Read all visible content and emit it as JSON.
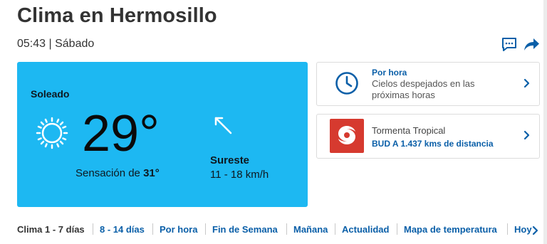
{
  "header": {
    "title": "Clima en Hermosillo",
    "time": "05:43",
    "separator": "|",
    "day": "Sábado"
  },
  "actions": {
    "comment_icon": "comment-icon",
    "share_icon": "share-icon"
  },
  "current": {
    "condition": "Soleado",
    "condition_icon": "sun-icon",
    "temperature": "29°",
    "feels_like_label": "Sensación de",
    "feels_like_value": "31°",
    "wind_icon": "wind-direction-arrow-icon",
    "wind_direction": "Sureste",
    "wind_speed": "11 - 18 km/h",
    "background_color": "#1db8f2"
  },
  "cards": {
    "hourly": {
      "icon": "clock-icon",
      "title": "Por hora",
      "text": "Cielos despejados en las próximas horas"
    },
    "storm": {
      "icon": "hurricane-icon",
      "title": "Tormenta Tropical",
      "text": "BUD A 1.437 kms de distancia",
      "icon_color": "#d63a2f"
    }
  },
  "nav": {
    "items": [
      {
        "label": "Clima 1 - 7 días",
        "active": true
      },
      {
        "label": "8 - 14 días",
        "active": false
      },
      {
        "label": "Por hora",
        "active": false
      },
      {
        "label": "Fin de Semana",
        "active": false
      },
      {
        "label": "Mañana",
        "active": false
      },
      {
        "label": "Actualidad",
        "active": false
      },
      {
        "label": "Mapa de temperatura",
        "active": false
      },
      {
        "label": "Hoy",
        "active": false
      }
    ],
    "next_icon": "chevron-right-icon"
  },
  "colors": {
    "link": "#0a5fa8",
    "accent": "#1db8f2"
  }
}
